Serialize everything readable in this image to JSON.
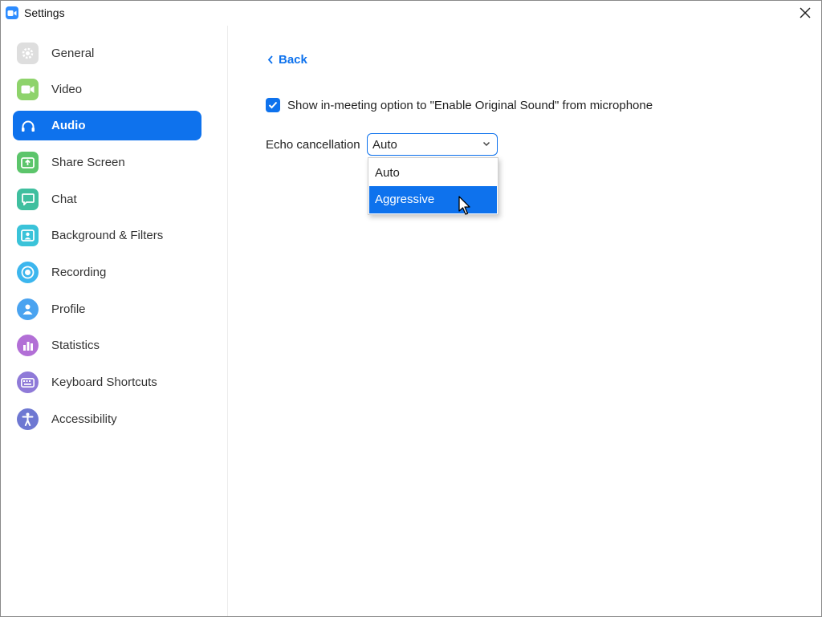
{
  "window": {
    "title": "Settings"
  },
  "sidebar": {
    "items": [
      {
        "label": "General",
        "icon": "gear-icon",
        "color": "#d9d9d9"
      },
      {
        "label": "Video",
        "icon": "video-camera-icon",
        "color": "#8ed36b"
      },
      {
        "label": "Audio",
        "icon": "headphones-icon",
        "color": "#0e72ed",
        "active": true
      },
      {
        "label": "Share Screen",
        "icon": "share-screen-icon",
        "color": "#5cc56b"
      },
      {
        "label": "Chat",
        "icon": "chat-bubble-icon",
        "color": "#3fbf9f"
      },
      {
        "label": "Background & Filters",
        "icon": "background-person-icon",
        "color": "#3ac3d9"
      },
      {
        "label": "Recording",
        "icon": "record-icon",
        "color": "#3cb6ee"
      },
      {
        "label": "Profile",
        "icon": "profile-icon",
        "color": "#4aa3f0"
      },
      {
        "label": "Statistics",
        "icon": "bar-chart-icon",
        "color": "#b26fd6"
      },
      {
        "label": "Keyboard Shortcuts",
        "icon": "keyboard-icon",
        "color": "#8f7ad8"
      },
      {
        "label": "Accessibility",
        "icon": "accessibility-icon",
        "color": "#6e78d2"
      }
    ]
  },
  "content": {
    "back_label": "Back",
    "original_sound_checkbox": {
      "checked": true,
      "label": "Show in-meeting option to \"Enable Original Sound\" from microphone"
    },
    "echo_cancellation": {
      "label": "Echo cancellation",
      "selected": "Auto",
      "options": [
        "Auto",
        "Aggressive"
      ],
      "highlighted": "Aggressive"
    }
  },
  "colors": {
    "accent": "#0e72ed"
  }
}
